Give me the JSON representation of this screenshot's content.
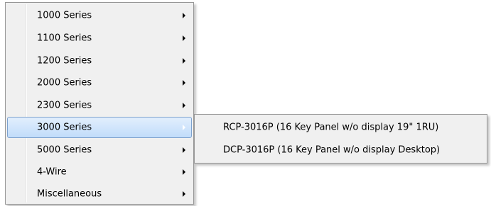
{
  "main_menu": {
    "items": [
      {
        "label": "1000 Series",
        "has_submenu": true
      },
      {
        "label": "1100 Series",
        "has_submenu": true
      },
      {
        "label": "1200 Series",
        "has_submenu": true
      },
      {
        "label": "2000 Series",
        "has_submenu": true
      },
      {
        "label": "2300 Series",
        "has_submenu": true
      },
      {
        "label": "3000 Series",
        "has_submenu": true,
        "highlighted": true
      },
      {
        "label": "5000 Series",
        "has_submenu": true
      },
      {
        "label": "4-Wire",
        "has_submenu": true
      },
      {
        "label": "Miscellaneous",
        "has_submenu": true
      }
    ]
  },
  "sub_menu": {
    "items": [
      {
        "label": "RCP-3016P (16 Key Panel w/o display 19\" 1RU)"
      },
      {
        "label": "DCP-3016P (16 Key Panel w/o display Desktop)"
      }
    ]
  },
  "colors": {
    "menu_background": "#f0f0f0",
    "menu_border": "#979797",
    "highlight_border": "#7da2ce",
    "highlight_gradient_top": "#e2effd",
    "highlight_gradient_bottom": "#c1dcfa"
  },
  "icons": {
    "submenu_arrow": "chevron-right-icon"
  }
}
